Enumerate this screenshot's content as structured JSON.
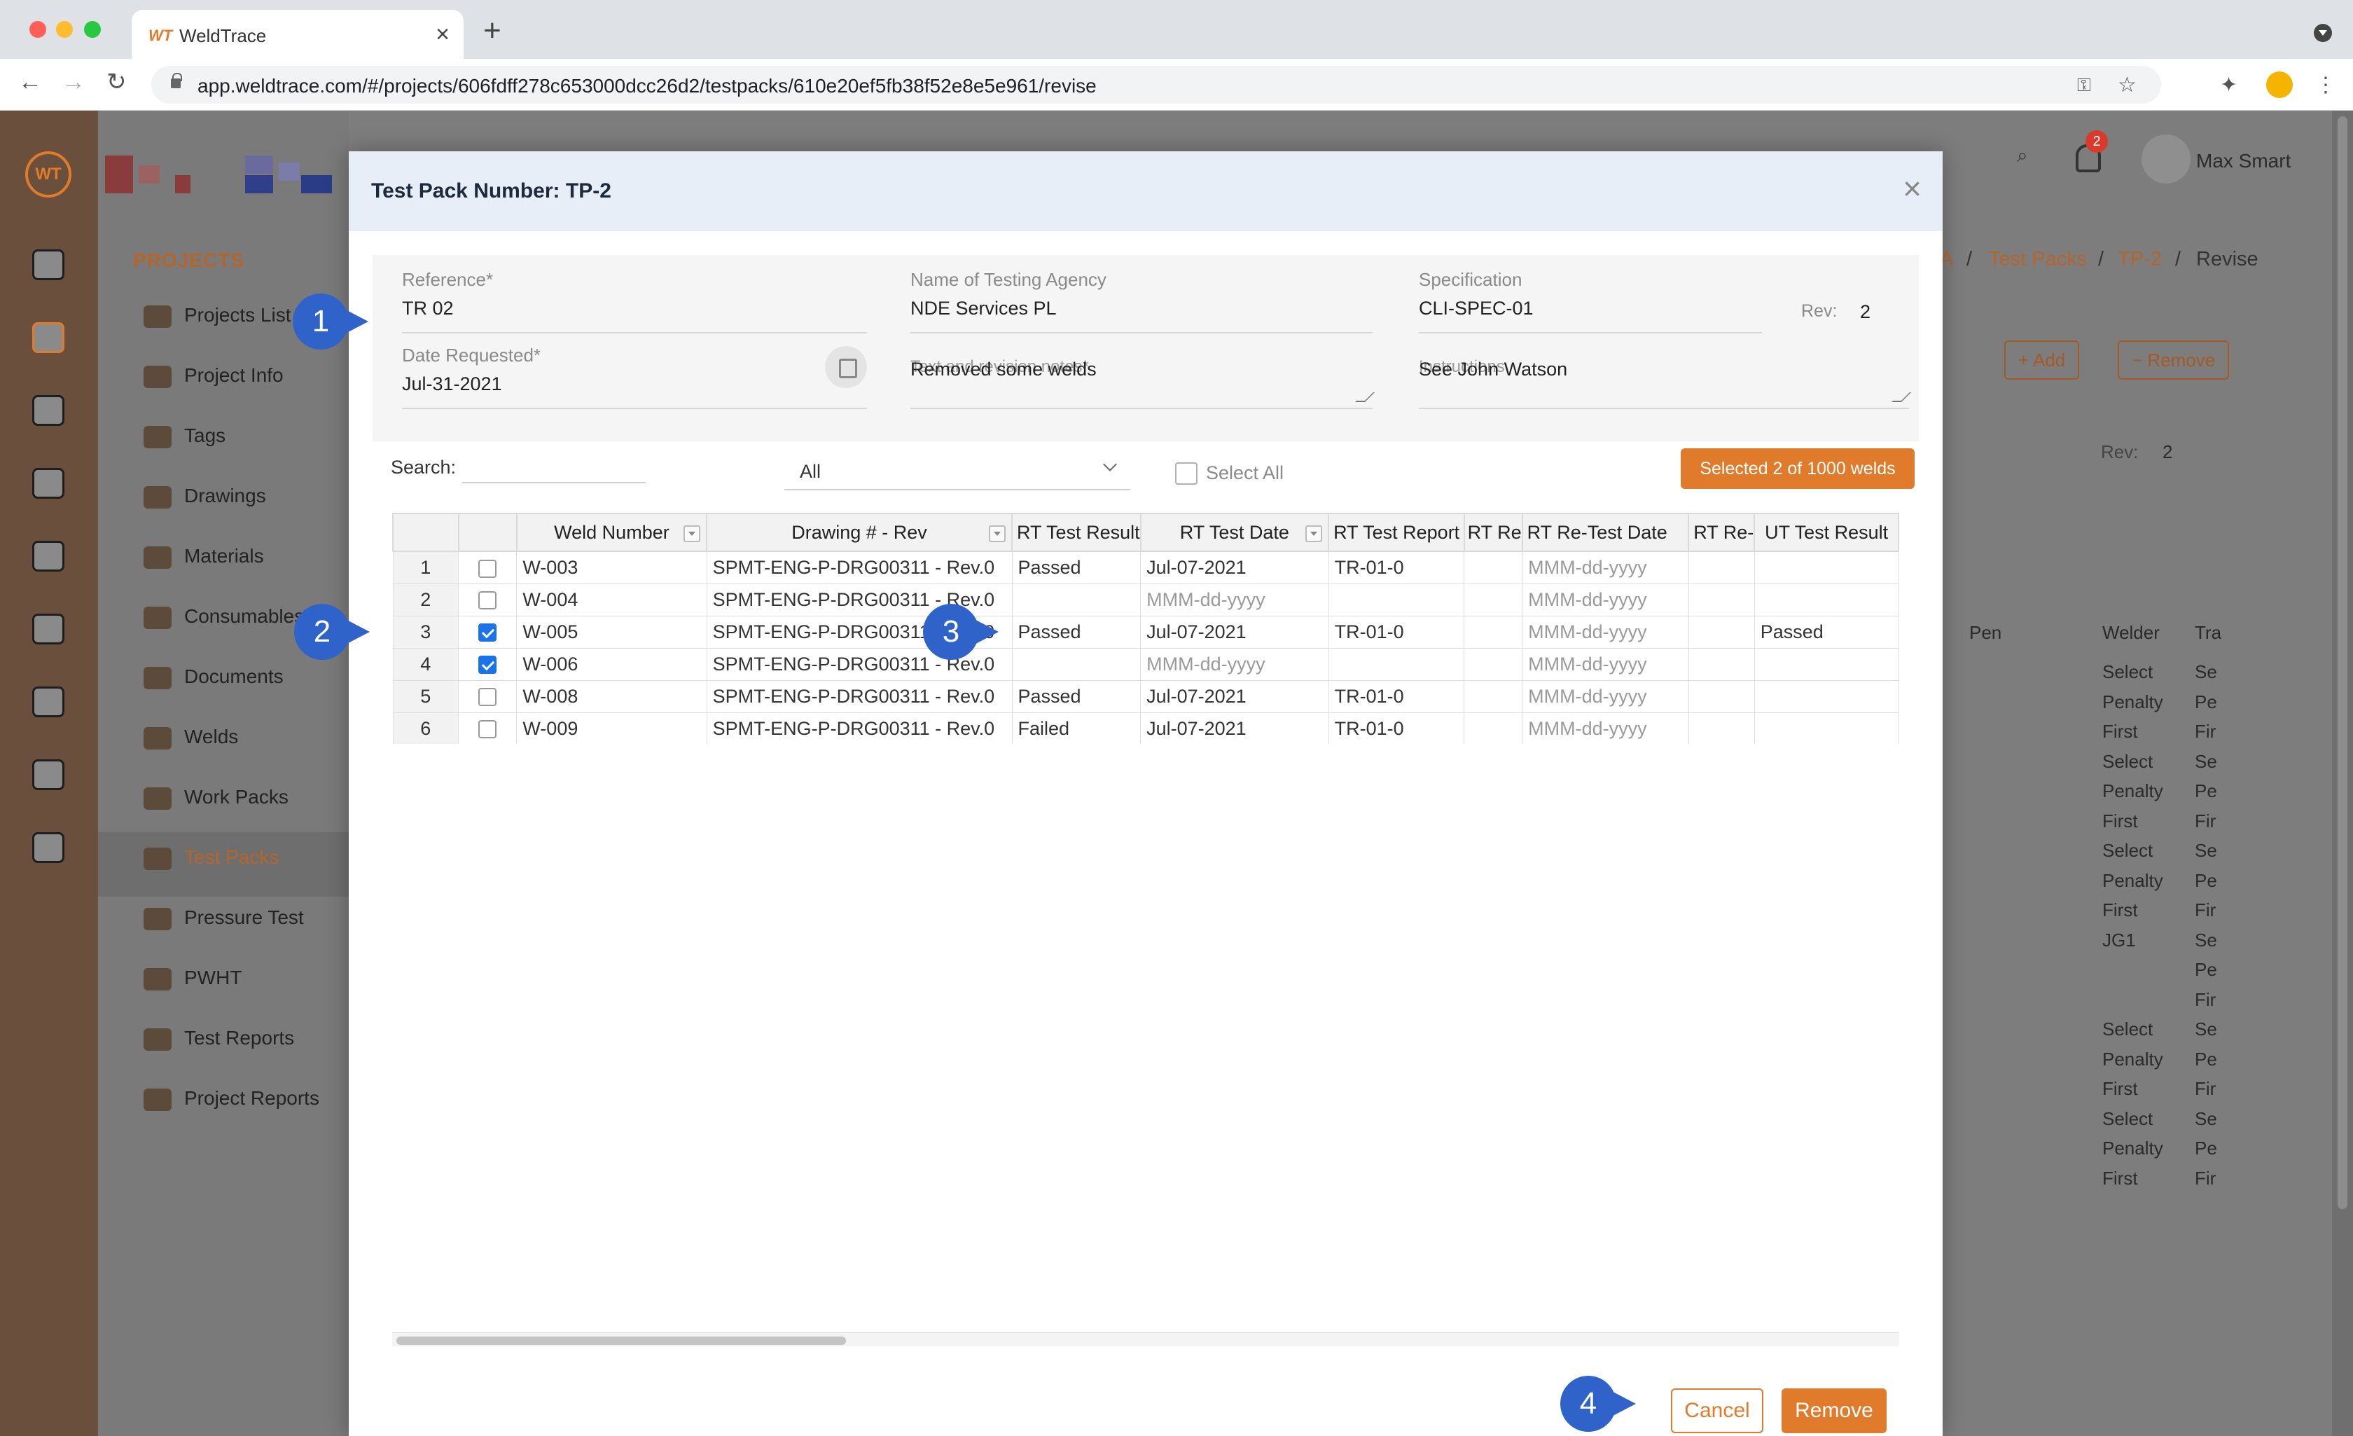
{
  "browser": {
    "tab_title": "WeldTrace",
    "tab_favicon": "WT",
    "url": "app.weldtrace.com/#/projects/606fdff278c653000dcc26d2/testpacks/610e20ef5fb38f52e8e5e961/revise"
  },
  "sidebar": {
    "section_title": "PROJECTS",
    "items": [
      {
        "label": "Projects List",
        "icon": "folder-icon"
      },
      {
        "label": "Project Info",
        "icon": "info-icon"
      },
      {
        "label": "Tags",
        "icon": "tag-icon"
      },
      {
        "label": "Drawings",
        "icon": "drawing-icon"
      },
      {
        "label": "Materials",
        "icon": "materials-icon"
      },
      {
        "label": "Consumables",
        "icon": "consumables-icon"
      },
      {
        "label": "Documents",
        "icon": "documents-icon"
      },
      {
        "label": "Welds",
        "icon": "welds-icon"
      },
      {
        "label": "Work Packs",
        "icon": "workpack-icon"
      },
      {
        "label": "Test Packs",
        "icon": "testpack-icon",
        "active": true
      },
      {
        "label": "Pressure Test",
        "icon": "pressure-icon"
      },
      {
        "label": "PWHT",
        "icon": "pwht-icon"
      },
      {
        "label": "Test Reports",
        "icon": "report-icon"
      },
      {
        "label": "Project Reports",
        "icon": "project-report-icon"
      }
    ]
  },
  "header": {
    "notification_count": "2",
    "avatar_text": "128 x 128",
    "user_name": "Max Smart"
  },
  "background": {
    "breadcrumb": [
      "A",
      "/",
      "Test Packs",
      "/",
      "TP-2",
      "/",
      "Revise"
    ],
    "add_label": "Add",
    "remove_label": "Remove",
    "rev_label": "Rev:",
    "rev_value": "2",
    "grid_headers": [
      "Pen",
      "Welder",
      "Tra"
    ],
    "welder_cells": [
      "Select",
      "Penalty",
      "First",
      "Select",
      "Penalty",
      "First",
      "Select",
      "Penalty",
      "First",
      "JG1",
      "",
      "",
      "Select",
      "Penalty",
      "First",
      "Select",
      "Penalty",
      "First"
    ],
    "tra_cells": [
      "Se",
      "Pe",
      "Fir",
      "Se",
      "Pe",
      "Fir",
      "Se",
      "Pe",
      "Fir",
      "Se",
      "Pe",
      "Fir",
      "Se",
      "Pe",
      "Fir",
      "Se",
      "Pe",
      "Fir"
    ]
  },
  "modal": {
    "title": "Test Pack Number: TP-2",
    "form": {
      "reference_label": "Reference*",
      "reference_value": "TR 02",
      "agency_label": "Name of Testing Agency",
      "agency_value": "NDE Services PL",
      "spec_label": "Specification",
      "spec_value": "CLI-SPEC-01",
      "rev_label": "Rev:",
      "rev_value": "2",
      "date_label": "Date Requested*",
      "date_value": "Jul-31-2021",
      "notes_label": "Text and revision notes*",
      "notes_value": "Removed some welds",
      "instructions_label": "Instructions",
      "instructions_value": "See John Watson"
    },
    "search_label": "Search:",
    "search_value": "",
    "filter_value": "All",
    "select_all_label": "Select All",
    "selected_badge": "Selected 2 of 1000 welds",
    "columns": [
      "",
      "",
      "Weld Number",
      "Drawing # - Rev",
      "RT Test Result",
      "RT Test Date",
      "RT Test Report",
      "RT Re",
      "RT Re-Test Date",
      "RT Re-",
      "UT Test Result"
    ],
    "rows": [
      {
        "n": "1",
        "checked": false,
        "weld": "W-003",
        "drawing": "SPMT-ENG-P-DRG00311 - Rev.0",
        "rt_result": "Passed",
        "rt_date": "Jul-07-2021",
        "rt_report": "TR-01-0",
        "rt_re": "",
        "rt_retest_date": "MMM-dd-yyyy",
        "rt_re2": "",
        "ut_result": ""
      },
      {
        "n": "2",
        "checked": false,
        "weld": "W-004",
        "drawing": "SPMT-ENG-P-DRG00311 - Rev.0",
        "rt_result": "",
        "rt_date": "MMM-dd-yyyy",
        "rt_report": "",
        "rt_re": "",
        "rt_retest_date": "MMM-dd-yyyy",
        "rt_re2": "",
        "ut_result": ""
      },
      {
        "n": "3",
        "checked": true,
        "weld": "W-005",
        "drawing": "SPMT-ENG-P-DRG00311 - Rev.0",
        "rt_result": "Passed",
        "rt_date": "Jul-07-2021",
        "rt_report": "TR-01-0",
        "rt_re": "",
        "rt_retest_date": "MMM-dd-yyyy",
        "rt_re2": "",
        "ut_result": "Passed"
      },
      {
        "n": "4",
        "checked": true,
        "weld": "W-006",
        "drawing": "SPMT-ENG-P-DRG00311 - Rev.0",
        "rt_result": "",
        "rt_date": "MMM-dd-yyyy",
        "rt_report": "",
        "rt_re": "",
        "rt_retest_date": "MMM-dd-yyyy",
        "rt_re2": "",
        "ut_result": ""
      },
      {
        "n": "5",
        "checked": false,
        "weld": "W-008",
        "drawing": "SPMT-ENG-P-DRG00311 - Rev.0",
        "rt_result": "Passed",
        "rt_date": "Jul-07-2021",
        "rt_report": "TR-01-0",
        "rt_re": "",
        "rt_retest_date": "MMM-dd-yyyy",
        "rt_re2": "",
        "ut_result": ""
      },
      {
        "n": "6",
        "checked": false,
        "weld": "W-009",
        "drawing": "SPMT-ENG-P-DRG00311 - Rev.0",
        "rt_result": "Failed",
        "rt_date": "Jul-07-2021",
        "rt_report": "TR-01-0",
        "rt_re": "",
        "rt_retest_date": "MMM-dd-yyyy",
        "rt_re2": "",
        "ut_result": ""
      }
    ],
    "cancel_label": "Cancel",
    "remove_label": "Remove"
  },
  "markers": [
    "1",
    "2",
    "3",
    "4"
  ],
  "colors": {
    "accent": "#e07b2c",
    "marker": "#2f63c9",
    "checkbox": "#1a73e8"
  }
}
